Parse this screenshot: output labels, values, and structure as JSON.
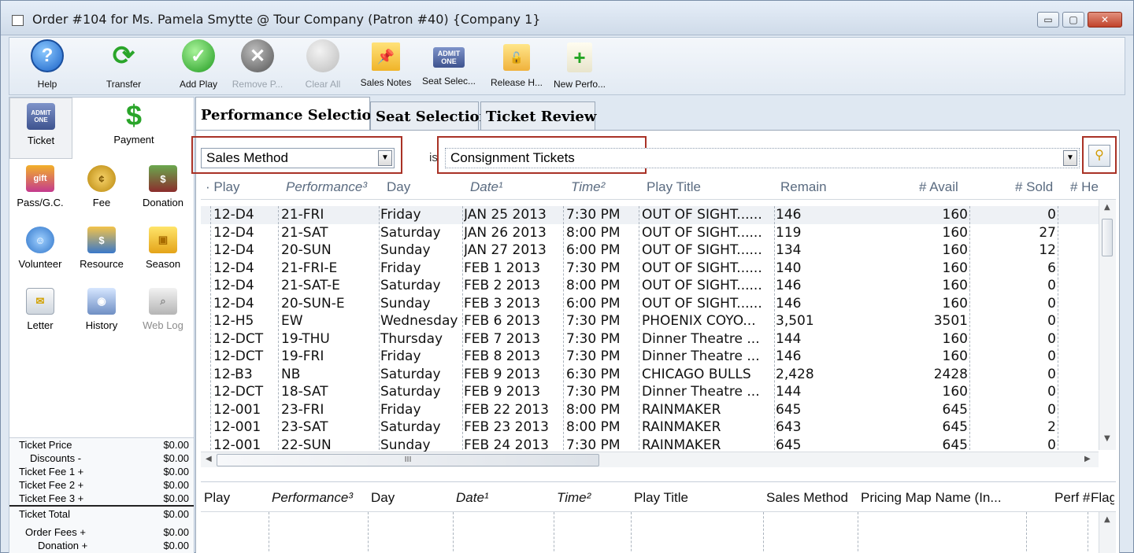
{
  "window": {
    "title": "Order #104 for Ms. Pamela Smytte @ Tour Company (Patron #40) {Company 1}",
    "minimize": "▭",
    "maximize": "▢",
    "close": "✕"
  },
  "toolbar": {
    "help": "Help",
    "transfer": "Transfer",
    "add_play": "Add Play",
    "remove_play": "Remove P...",
    "clear_all": "Clear All",
    "sales_notes": "Sales Notes",
    "seat_select": "Seat Selec...",
    "release_hold": "Release H...",
    "new_perf": "New Perfo..."
  },
  "left_panel": {
    "ticket": "Ticket",
    "payment": "Payment",
    "pass_gc": "Pass/G.C.",
    "fee": "Fee",
    "donation": "Donation",
    "volunteer": "Volunteer",
    "resource": "Resource",
    "season": "Season",
    "letter": "Letter",
    "history": "History",
    "web_log": "Web Log"
  },
  "totals": [
    {
      "label": "Ticket Price",
      "value": "$0.00"
    },
    {
      "label": "Discounts -",
      "value": "$0.00"
    },
    {
      "label": "Ticket Fee 1 +",
      "value": "$0.00"
    },
    {
      "label": "Ticket Fee 2 +",
      "value": "$0.00"
    },
    {
      "label": "Ticket Fee 3 +",
      "value": "$0.00"
    },
    {
      "label": "Ticket Total",
      "value": "$0.00"
    },
    {
      "label": "Order Fees +",
      "value": "$0.00"
    },
    {
      "label": "Donation +",
      "value": "$0.00"
    }
  ],
  "tabs": {
    "performance_selection": "Performance Selection",
    "seat_selection": "Seat Selection",
    "ticket_review": "Ticket Review"
  },
  "filter": {
    "field": "Sales Method",
    "operator": "is",
    "value": "Consignment Tickets"
  },
  "grid": {
    "headers": [
      "Play",
      "Performance³",
      "Day",
      "Date¹",
      "Time²",
      "Play Title",
      "Remain",
      "# Avail",
      "# Sold",
      "# Held"
    ],
    "rows": [
      [
        "12-D4",
        "21-FRI",
        "Friday",
        "JAN 25 2013",
        "7:30 PM",
        "OUT OF SIGHT......",
        "146",
        "160",
        "0"
      ],
      [
        "12-D4",
        "21-SAT",
        "Saturday",
        "JAN 26 2013",
        "8:00 PM",
        "OUT OF SIGHT......",
        "119",
        "160",
        "27"
      ],
      [
        "12-D4",
        "20-SUN",
        "Sunday",
        "JAN 27 2013",
        "6:00 PM",
        "OUT OF SIGHT......",
        "134",
        "160",
        "12"
      ],
      [
        "12-D4",
        "21-FRI-E",
        "Friday",
        "FEB 1 2013",
        "7:30 PM",
        "OUT OF SIGHT......",
        "140",
        "160",
        "6"
      ],
      [
        "12-D4",
        "21-SAT-E",
        "Saturday",
        "FEB 2 2013",
        "8:00 PM",
        "OUT OF SIGHT......",
        "146",
        "160",
        "0"
      ],
      [
        "12-D4",
        "20-SUN-E",
        "Sunday",
        "FEB 3 2013",
        "6:00 PM",
        "OUT OF SIGHT......",
        "146",
        "160",
        "0"
      ],
      [
        "12-H5",
        "EW",
        "Wednesday",
        "FEB 6 2013",
        "7:30 PM",
        "PHOENIX COYO...",
        "3,501",
        "3501",
        "0"
      ],
      [
        "12-DCT",
        "19-THU",
        "Thursday",
        "FEB 7 2013",
        "7:30 PM",
        "Dinner Theatre ...",
        "144",
        "160",
        "0"
      ],
      [
        "12-DCT",
        "19-FRI",
        "Friday",
        "FEB 8 2013",
        "7:30 PM",
        "Dinner Theatre ...",
        "146",
        "160",
        "0"
      ],
      [
        "12-B3",
        "NB",
        "Saturday",
        "FEB 9 2013",
        "6:30 PM",
        "CHICAGO BULLS",
        "2,428",
        "2428",
        "0"
      ],
      [
        "12-DCT",
        "18-SAT",
        "Saturday",
        "FEB 9 2013",
        "7:30 PM",
        "Dinner Theatre ...",
        "144",
        "160",
        "0"
      ],
      [
        "12-001",
        "23-FRI",
        "Friday",
        "FEB 22 2013",
        "8:00 PM",
        "RAINMAKER",
        "645",
        "645",
        "0"
      ],
      [
        "12-001",
        "23-SAT",
        "Saturday",
        "FEB 23 2013",
        "8:00 PM",
        "RAINMAKER",
        "643",
        "645",
        "2"
      ],
      [
        "12-001",
        "22-SUN",
        "Sunday",
        "FEB 24 2013",
        "7:30 PM",
        "RAINMAKER",
        "645",
        "645",
        "0"
      ]
    ],
    "hscroll_grip": "III"
  },
  "lower_grid": {
    "headers": [
      "Play",
      "Performance³",
      "Day",
      "Date¹",
      "Time²",
      "Play Title",
      "Sales Method",
      "Pricing Map Name (In...",
      "Perf #",
      "Flag"
    ]
  }
}
